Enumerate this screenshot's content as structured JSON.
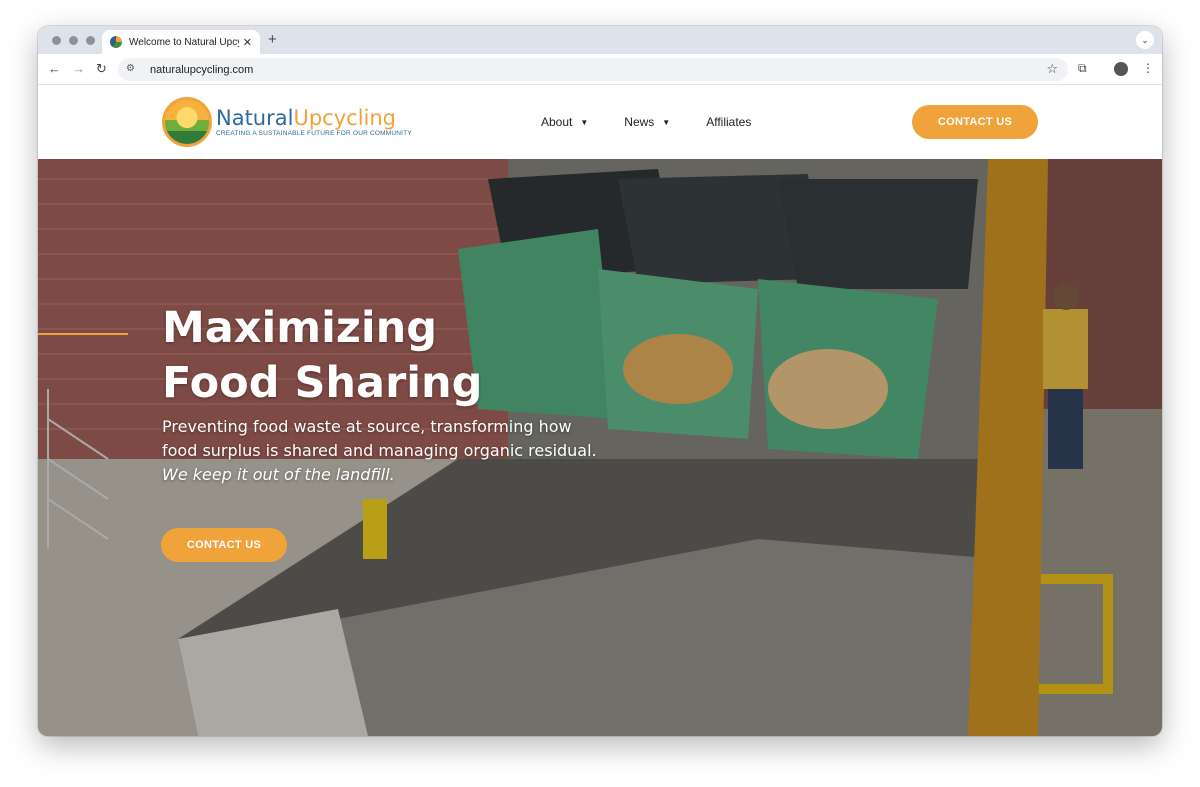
{
  "browser": {
    "tab_title": "Welcome to Natural Upcycling",
    "url": "naturalupcycling.com",
    "icons": {
      "back": "arrow-left-icon",
      "forward": "arrow-right-icon",
      "reload": "reload-icon",
      "bookmark": "star-icon",
      "extensions": "puzzle-icon",
      "menu": "kebab-icon"
    }
  },
  "site": {
    "logo": {
      "name_part1": "Natural",
      "name_part2": "Upcycling",
      "tagline": "CREATING A SUSTAINABLE FUTURE FOR OUR COMMUNITY"
    },
    "nav": [
      {
        "label": "About",
        "has_dropdown": true
      },
      {
        "label": "News",
        "has_dropdown": true
      },
      {
        "label": "Affiliates",
        "has_dropdown": false
      }
    ],
    "header_cta": "CONTACT US",
    "colors": {
      "accent": "#f0a33b",
      "brand_blue": "#2d6b9a"
    }
  },
  "hero": {
    "title_line1": "Maximizing",
    "title_line2": "Food Sharing",
    "subtitle": "Preventing food waste at source, transforming how food surplus is shared and managing organic residual.",
    "tagline": "We keep it out of the landfill.",
    "cta": "CONTACT US"
  }
}
